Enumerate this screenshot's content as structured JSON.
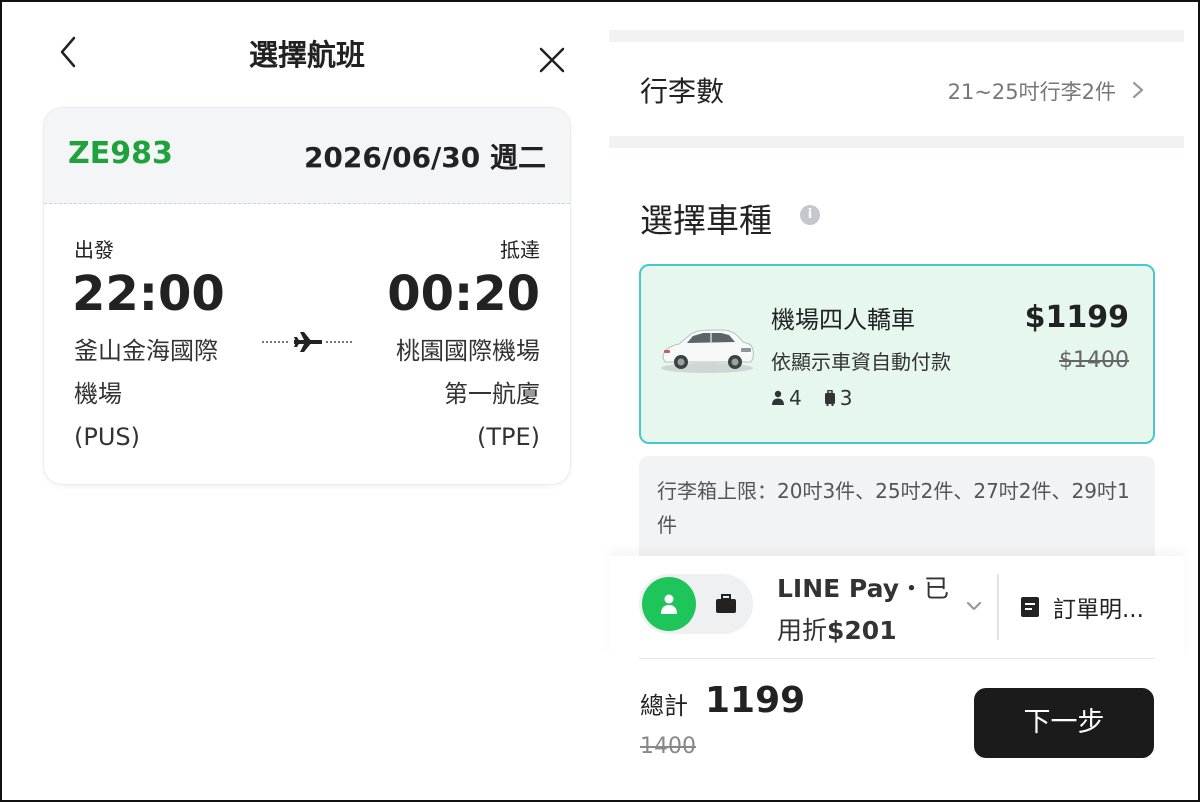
{
  "header": {
    "title": "選擇航班"
  },
  "flight": {
    "number": "ZE983",
    "date": "2026/06/30 週二",
    "departure": {
      "label": "出發",
      "time": "22:00",
      "airport_line1": "釜山金海國際",
      "airport_line2": "機場",
      "code": "(PUS)"
    },
    "arrival": {
      "label": "抵達",
      "time": "00:20",
      "airport_line1": "桃園國際機場",
      "airport_line2": "第一航廈",
      "code": "(TPE)"
    }
  },
  "luggage": {
    "label": "行李數",
    "value": "21~25吋行李2件"
  },
  "vehicle_section": {
    "title": "選擇車種"
  },
  "vehicle": {
    "name": "機場四人轎車",
    "description": "依顯示車資自動付款",
    "price": "$1199",
    "original_price": "$1400",
    "passengers": "4",
    "bags": "3"
  },
  "luggage_limit": {
    "text": "行李箱上限：20吋3件、25吋2件、27吋2件、29吋1件"
  },
  "payment": {
    "method": "LINE Pay",
    "separator": "・已",
    "discount_prefix": "用折",
    "discount_amount": "$201"
  },
  "order": {
    "label": "訂單明..."
  },
  "total": {
    "label": "總計",
    "value": "1199",
    "original": "1400"
  },
  "next_button": {
    "label": "下一步"
  },
  "colors": {
    "brand_green": "#1fa23c",
    "toggle_green": "#1ec55b",
    "card_bg": "#e6f8ee",
    "card_border": "#49c7c9",
    "button_dark": "#1b1b1b"
  },
  "icons": {
    "back": "chevron-left-icon",
    "close": "close-icon",
    "plane": "airplane-icon",
    "chevron": "chevron-right-icon",
    "info": "info-icon",
    "person": "person-icon",
    "bag": "luggage-icon",
    "order": "document-icon"
  }
}
